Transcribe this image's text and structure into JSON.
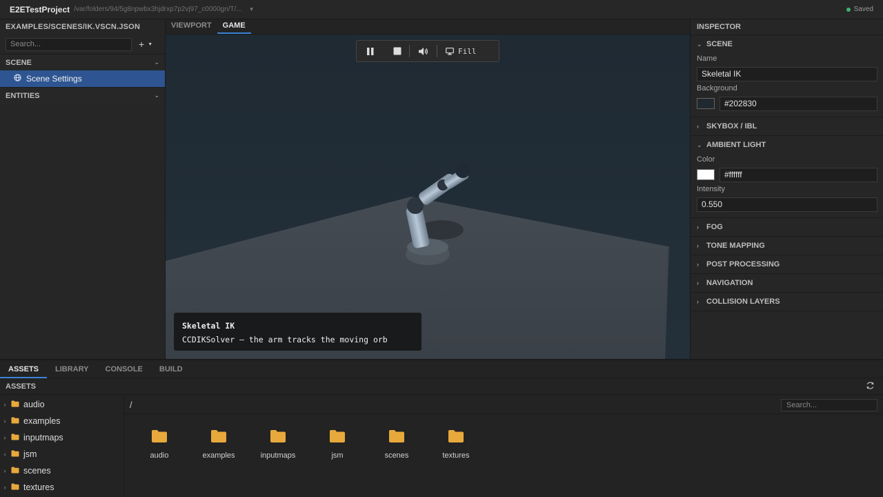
{
  "app": {
    "title": "E2ETestProject",
    "path": "/var/folders/94/5g8npwbx3hjdrxp7p2vj97_c0000gn/T/...",
    "status": "Saved",
    "status_color": "#3cb371"
  },
  "hierarchy": {
    "scene_path": "EXAMPLES/SCENES/IK.VSCN.JSON",
    "search_placeholder": "Search...",
    "add_label": "+",
    "scene_section": "SCENE",
    "scene_settings_label": "Scene Settings",
    "entities_section": "ENTITIES",
    "selected_color": "#2e5592"
  },
  "viewport": {
    "tabs": [
      {
        "label": "VIEWPORT",
        "active": false
      },
      {
        "label": "GAME",
        "active": true
      }
    ],
    "toolbar": {
      "pause_icon": "pause-icon",
      "stop_icon": "stop-icon",
      "volume_icon": "volume-icon",
      "fill_label": "Fill"
    },
    "caption": {
      "title": "Skeletal IK",
      "subtitle": "CCDIKSolver — the arm tracks the moving orb"
    }
  },
  "inspector": {
    "title": "INSPECTOR",
    "scene_section": "SCENE",
    "name_label": "Name",
    "name_value": "Skeletal IK",
    "background_label": "Background",
    "background_value": "#202830",
    "skybox_section": "SKYBOX / IBL",
    "ambient_section": "AMBIENT LIGHT",
    "color_label": "Color",
    "color_value": "#ffffff",
    "intensity_label": "Intensity",
    "intensity_value": "0.550",
    "collapsed_sections": [
      "FOG",
      "TONE MAPPING",
      "POST PROCESSING",
      "NAVIGATION",
      "COLLISION LAYERS"
    ]
  },
  "bottom": {
    "tabs": [
      {
        "label": "ASSETS",
        "active": true
      },
      {
        "label": "LIBRARY",
        "active": false
      },
      {
        "label": "CONSOLE",
        "active": false
      },
      {
        "label": "BUILD",
        "active": false
      }
    ],
    "assets_header": "ASSETS",
    "path": "/",
    "search_placeholder": "Search...",
    "folders": [
      "audio",
      "examples",
      "inputmaps",
      "jsm",
      "scenes",
      "textures"
    ],
    "folder_color": "#e8a93c"
  }
}
